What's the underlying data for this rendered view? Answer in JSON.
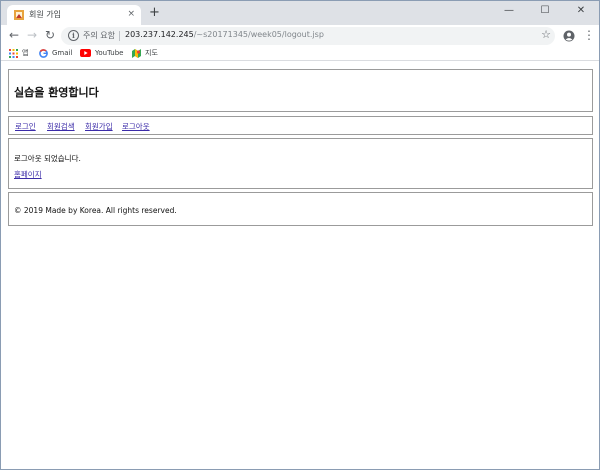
{
  "browser": {
    "tab_title": "회원 가입",
    "tab_close": "×",
    "new_tab": "+",
    "window_controls": {
      "minimize": "—",
      "maximize": "☐",
      "close": "✕"
    },
    "nav": {
      "back": "←",
      "forward": "→",
      "reload": "↻"
    },
    "security_text": "주의 요함",
    "url_host": "203.237.142.245",
    "url_path": "/~s20171345/week05/logout.jsp",
    "star": "☆",
    "menu": "⋮",
    "bookmarks": [
      {
        "label": "앱",
        "icon": "apps-grid-icon"
      },
      {
        "label": "Gmail",
        "icon": "google-icon"
      },
      {
        "label": "YouTube",
        "icon": "youtube-icon"
      },
      {
        "label": "지도",
        "icon": "maps-icon"
      }
    ]
  },
  "page": {
    "title": "실습을 환영합니다",
    "nav": [
      "로그인",
      "회원검색",
      "회원가입",
      "로그아웃"
    ],
    "message": "로그아웃 되었습니다.",
    "home_link": "홈페이지",
    "footer": "© 2019 Made by Korea. All rights reserved."
  }
}
